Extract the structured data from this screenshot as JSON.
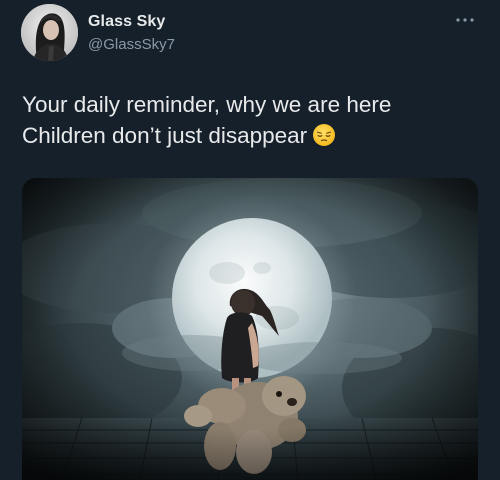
{
  "tweet": {
    "author": {
      "display_name": "Glass Sky",
      "handle": "@GlassSky7"
    },
    "text": {
      "line1": "Your daily reminder, why we are here",
      "line2": "Children don’t just disappear",
      "emoji": "pensive-face-emoji"
    },
    "more_icon": "more-dots-icon",
    "media": {
      "kind": "photo",
      "subject": "girl-with-teddy-bear-under-full-moon"
    }
  },
  "colors": {
    "background": "#16202b",
    "text": "#e7e9ea",
    "secondary_text": "#8b98a5"
  }
}
